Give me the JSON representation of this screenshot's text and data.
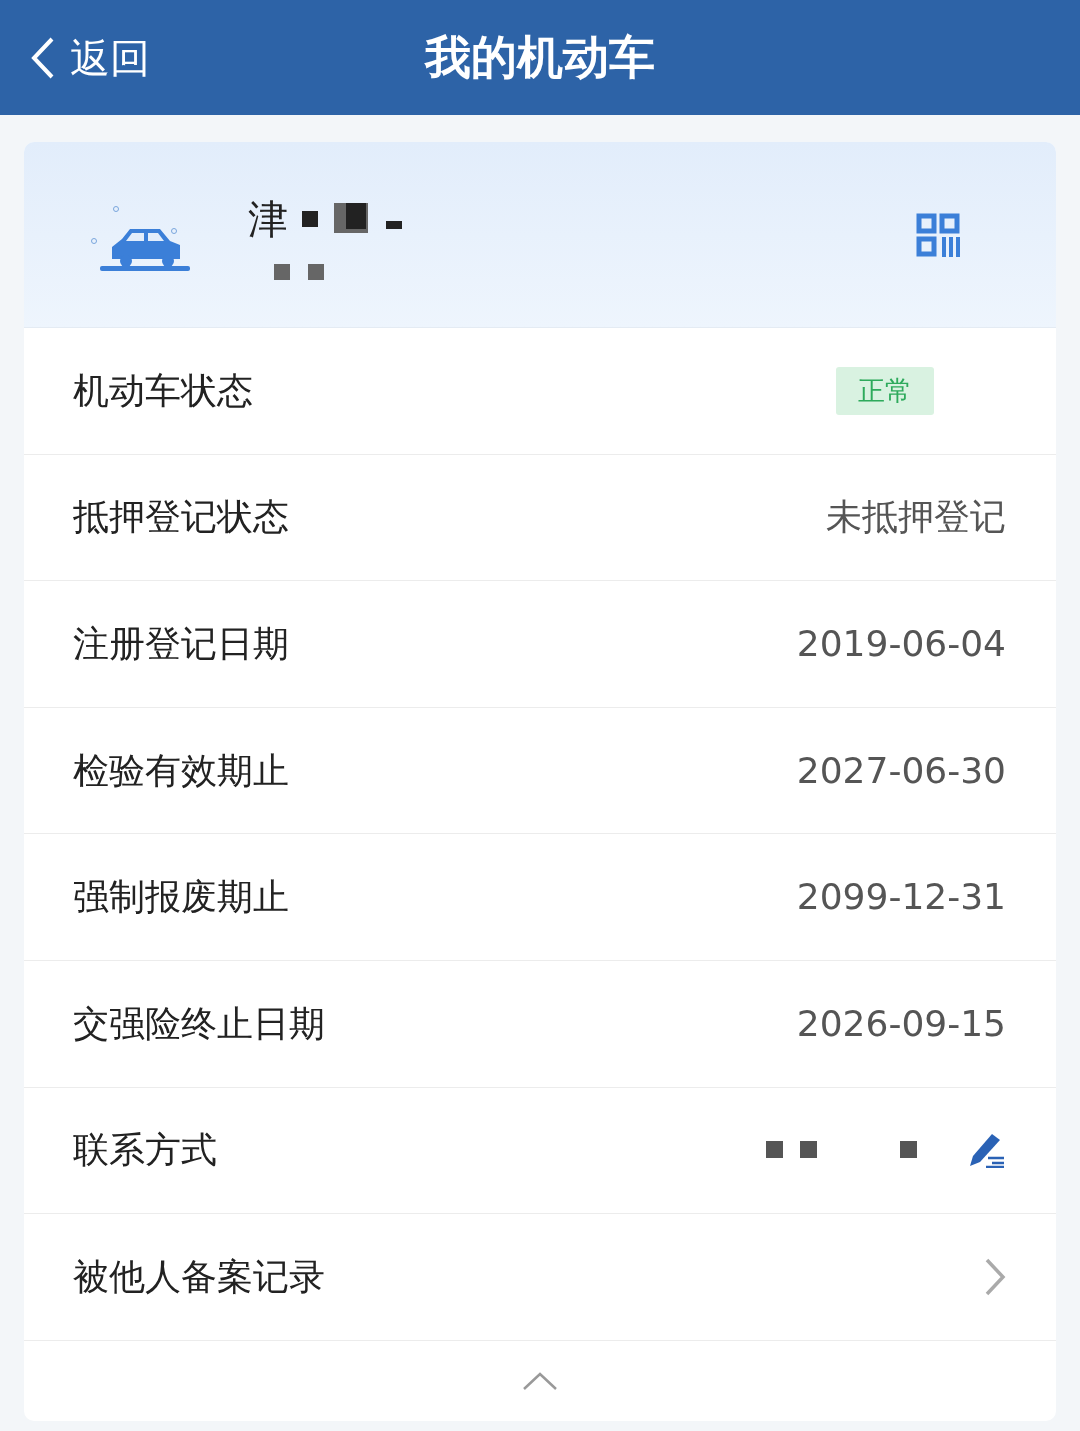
{
  "header": {
    "back_label": "返回",
    "title": "我的机动车"
  },
  "vehicle": {
    "plate": "津"
  },
  "rows": [
    {
      "kind": "badge",
      "label": "机动车状态",
      "value": "正常"
    },
    {
      "kind": "text",
      "label": "抵押登记状态",
      "value": "未抵押登记"
    },
    {
      "kind": "text",
      "label": "注册登记日期",
      "value": "2019-06-04"
    },
    {
      "kind": "text",
      "label": "检验有效期止",
      "value": "2027-06-30"
    },
    {
      "kind": "text",
      "label": "强制报废期止",
      "value": "2099-12-31"
    },
    {
      "kind": "text",
      "label": "交强险终止日期",
      "value": "2026-09-15"
    },
    {
      "kind": "contact",
      "label": "联系方式"
    },
    {
      "kind": "link",
      "label": "被他人备案记录"
    }
  ]
}
